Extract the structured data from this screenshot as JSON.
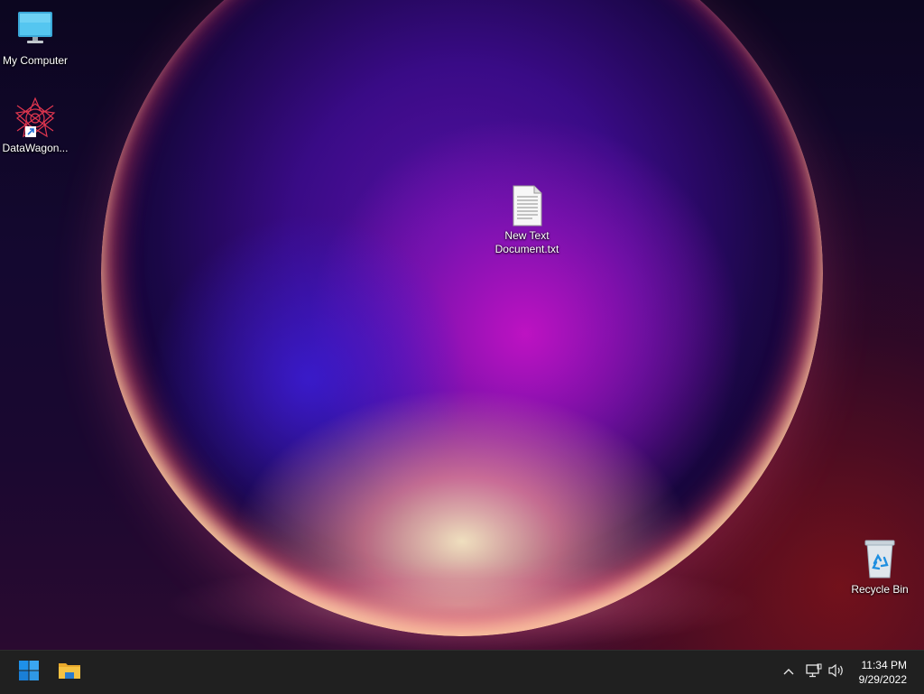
{
  "desktop": {
    "icons": [
      {
        "label": "My Computer",
        "icon": "monitor-icon"
      },
      {
        "label": "DataWagon...",
        "icon": "datawagon-shortcut-icon"
      },
      {
        "label": "New Text Document.txt",
        "label_line1": "New Text",
        "label_line2": "Document.txt",
        "icon": "text-document-icon"
      },
      {
        "label": "Recycle Bin",
        "icon": "recycle-bin-icon"
      }
    ]
  },
  "taskbar": {
    "start_icon": "windows-start-icon",
    "pinned": [
      {
        "name": "File Explorer",
        "icon": "folder-icon"
      }
    ],
    "tray": {
      "chevron_icon": "chevron-up-icon",
      "network_icon": "network-icon",
      "volume_icon": "speaker-icon"
    },
    "clock": {
      "time": "11:34 PM",
      "date": "9/29/2022"
    }
  },
  "colors": {
    "taskbar_bg": "#202020",
    "start_blue": "#1e90e8",
    "folder_yellow": "#f5c242"
  }
}
